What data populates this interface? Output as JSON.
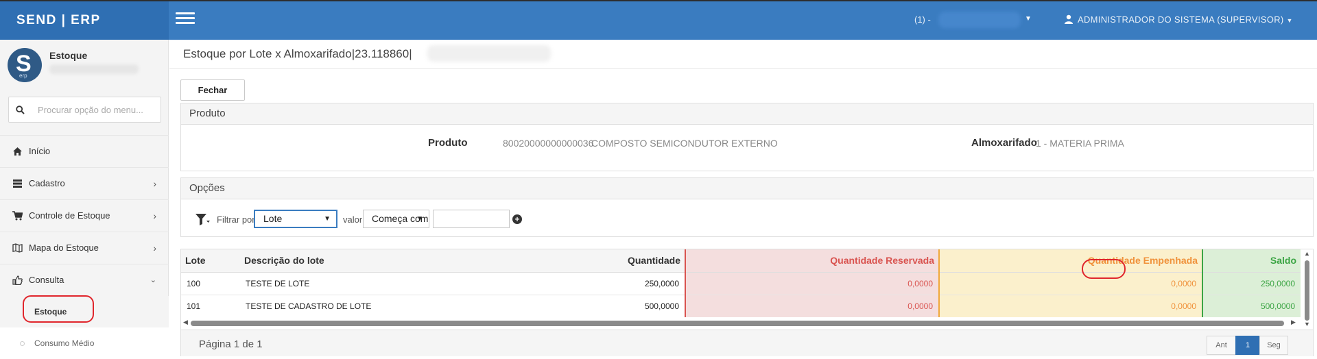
{
  "header": {
    "brand": "SEND | ERP",
    "company_selector": "(1) -",
    "user": "ADMINISTRADOR DO SISTEMA (SUPERVISOR)"
  },
  "sidebar": {
    "module_title": "Estoque",
    "logo_letter": "S",
    "logo_sub": "erp",
    "search_placeholder": "Procurar opção do menu...",
    "items": [
      {
        "label": "Início",
        "icon": "home-icon"
      },
      {
        "label": "Cadastro",
        "icon": "list-icon"
      },
      {
        "label": "Controle de Estoque",
        "icon": "cart-icon"
      },
      {
        "label": "Mapa do Estoque",
        "icon": "map-icon"
      },
      {
        "label": "Consulta",
        "icon": "thumbs-up-icon"
      }
    ],
    "subitems": [
      {
        "label": "Estoque"
      },
      {
        "label": "Consumo Médio"
      }
    ]
  },
  "main": {
    "title": "Estoque por Lote x Almoxarifado|23.118860|",
    "close_button": "Fechar",
    "product_panel": {
      "heading": "Produto",
      "product_label": "Produto",
      "product_code": "80020000000000036",
      "product_desc": "COMPOSTO SEMICONDUTOR EXTERNO",
      "warehouse_label": "Almoxarifado",
      "warehouse_value": "1 - MATERIA PRIMA"
    },
    "options_panel": {
      "heading": "Opções",
      "filter_label": "Filtrar por",
      "filter_value": "Lote",
      "value_label": "valor",
      "operator_value": "Começa com",
      "add_symbol": "+"
    },
    "table": {
      "columns": [
        "Lote",
        "Descrição do lote",
        "Quantidade",
        "Quantidade Reservada",
        "Quantidade Empenhada",
        "Saldo"
      ],
      "rows": [
        {
          "lote": "100",
          "descricao": "TESTE DE LOTE",
          "quantidade": "250,0000",
          "reservada": "0,0000",
          "empenhada": "0,0000",
          "saldo": "250,0000"
        },
        {
          "lote": "101",
          "descricao": "TESTE DE CADASTRO DE LOTE",
          "quantidade": "500,0000",
          "reservada": "0,0000",
          "empenhada": "0,0000",
          "saldo": "500,0000"
        }
      ]
    },
    "pager": {
      "info": "Página 1 de 1",
      "prev": "Ant",
      "current": "1",
      "next": "Seg"
    }
  },
  "colors": {
    "header_blue": "#3a7cc0",
    "reserved_red": "#d9534f",
    "committed_orange": "#f0923b",
    "balance_green": "#3ca544",
    "annotation_red": "#e0262c"
  }
}
